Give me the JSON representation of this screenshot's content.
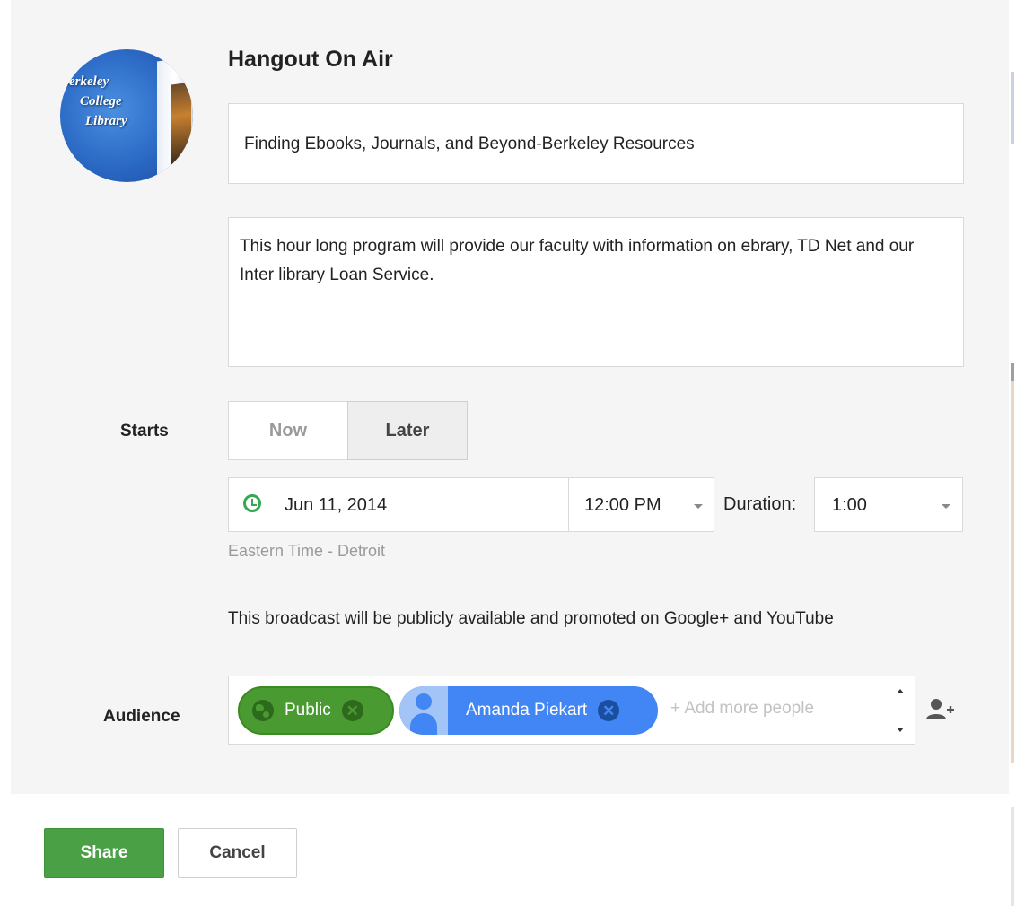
{
  "avatar": {
    "lines": [
      "Berkeley",
      "College",
      "Library"
    ]
  },
  "dialog": {
    "title": "Hangout On Air",
    "event_title": "Finding Ebooks, Journals, and Beyond-Berkeley Resources",
    "description": "This hour long program will provide our faculty with information on ebrary, TD Net and our Inter library Loan Service."
  },
  "starts": {
    "label": "Starts",
    "now_label": "Now",
    "later_label": "Later",
    "selected": "Later",
    "date": "Jun 11, 2014",
    "time": "12:00 PM",
    "duration_label": "Duration:",
    "duration": "1:00",
    "timezone": "Eastern Time - Detroit"
  },
  "notice": "This broadcast will be publicly available and promoted on Google+ and YouTube",
  "audience": {
    "label": "Audience",
    "chips": [
      {
        "label": "Public",
        "color": "#4a9a32",
        "icon": "globe-icon"
      },
      {
        "label": "Amanda Piekart",
        "color": "#4285f4",
        "icon": "person-avatar-icon"
      }
    ],
    "placeholder": "+ Add more people"
  },
  "actions": {
    "share_label": "Share",
    "cancel_label": "Cancel"
  },
  "colors": {
    "accent_green": "#4aa145",
    "accent_blue": "#4285f4",
    "clock_icon": "#34a853"
  }
}
